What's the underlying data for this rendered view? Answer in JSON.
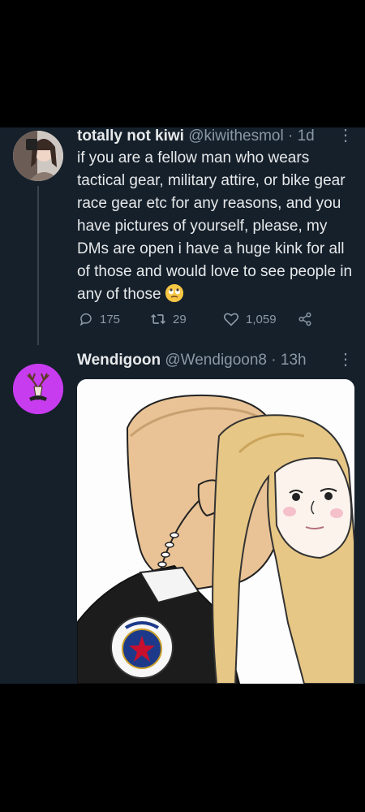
{
  "tweets": [
    {
      "name": "totally not kiwi",
      "handle": "@kiwithesmol",
      "time": "· 1d",
      "text": "if you are a fellow man who wears tactical gear, military attire, or bike gear race gear etc for any reasons, and you have pictures of yourself, please, my DMs are open i have a huge kink for all of those and would love to see people in any of those",
      "emoji": "rolling-eyes-emoji",
      "replies": "175",
      "retweets": "29",
      "likes": "1,059"
    },
    {
      "name": "Wendigoon",
      "handle": "@Wendigoon8",
      "time": "· 13h"
    }
  ],
  "icons": {
    "more": "more-options-icon",
    "reply": "reply-icon",
    "retweet": "retweet-icon",
    "like": "heart-icon",
    "share": "share-icon"
  },
  "colors": {
    "background": "#15202b",
    "secondary_text": "#8b98a5",
    "avatar_purple": "#c83cf0"
  }
}
